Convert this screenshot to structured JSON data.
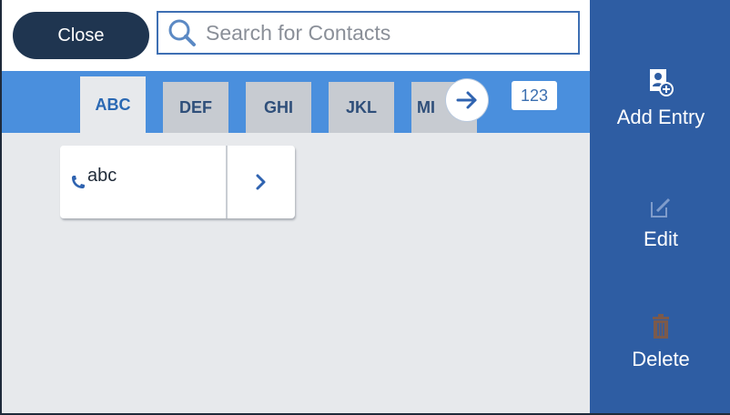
{
  "topbar": {
    "close_label": "Close",
    "search_placeholder": "Search for Contacts"
  },
  "tabs": [
    {
      "label": "ABC",
      "active": true
    },
    {
      "label": "DEF",
      "active": false
    },
    {
      "label": "GHI",
      "active": false
    },
    {
      "label": "JKL",
      "active": false
    },
    {
      "label": "MI",
      "active": false
    }
  ],
  "number_tab": "123",
  "contacts": [
    {
      "name": "abc",
      "icon": "phone-icon"
    }
  ],
  "sidebar": {
    "add_entry_label": "Add Entry",
    "edit_label": "Edit",
    "delete_label": "Delete"
  },
  "colors": {
    "accent": "#2e5da3",
    "tab_strip": "#4a8fdd",
    "close_button": "#1f3550"
  }
}
